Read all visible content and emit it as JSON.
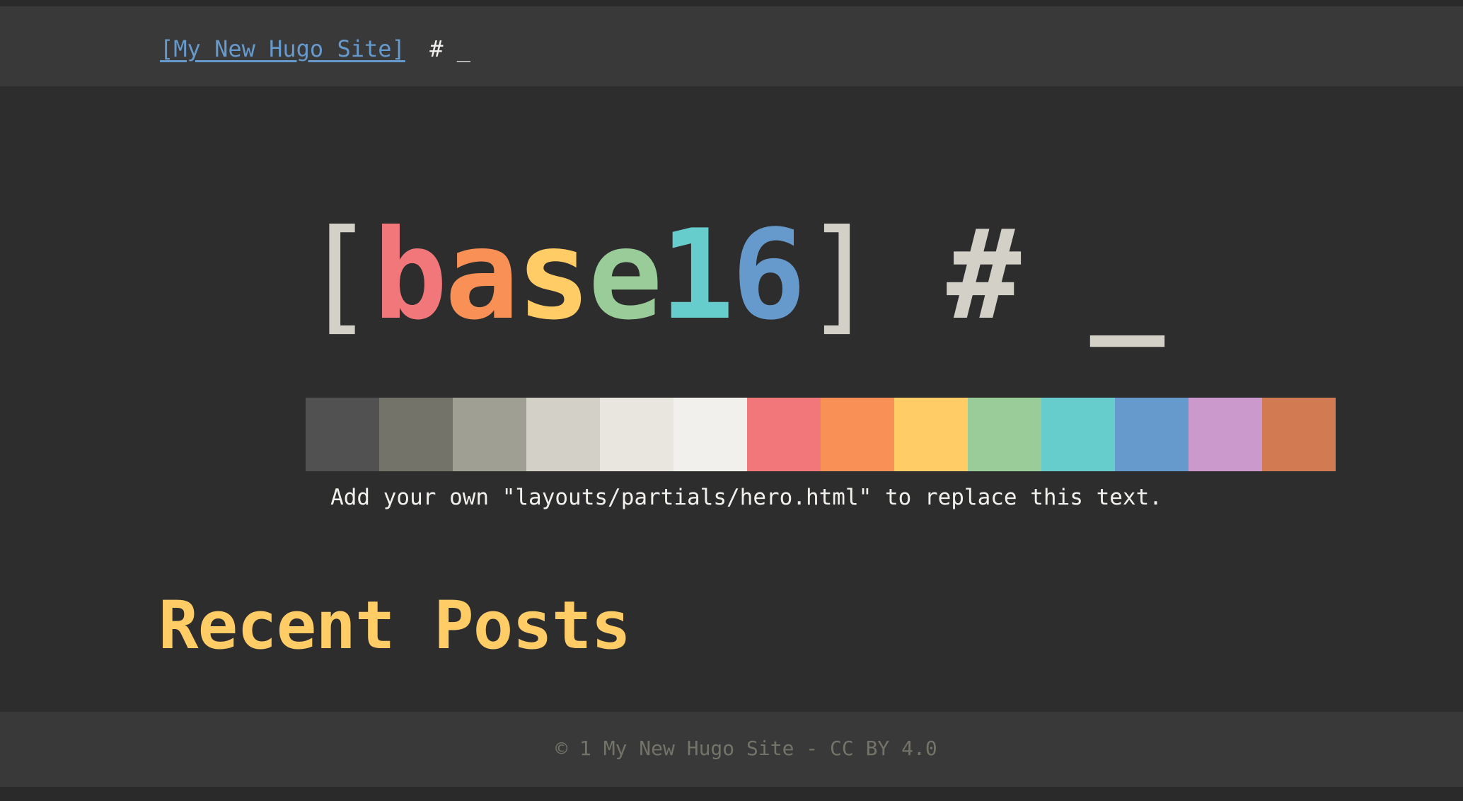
{
  "header": {
    "site_title": "[My New Hugo Site]",
    "prompt": " # _"
  },
  "hero": {
    "logo": {
      "open_bracket": "[",
      "letters": [
        {
          "char": "b",
          "color": "#f2777a"
        },
        {
          "char": "a",
          "color": "#f99157"
        },
        {
          "char": "s",
          "color": "#ffcc66"
        },
        {
          "char": "e",
          "color": "#99cc99"
        },
        {
          "char": "1",
          "color": "#66cccc"
        },
        {
          "char": "6",
          "color": "#6699cc"
        }
      ],
      "close_bracket": "]",
      "tail": " # _"
    },
    "palette": [
      "#2d2d2d",
      "#515151",
      "#747369",
      "#a09f93",
      "#d3d0c8",
      "#e8e6df",
      "#f2f0ec",
      "#f2777a",
      "#f99157",
      "#ffcc66",
      "#99cc99",
      "#66cccc",
      "#6699cc",
      "#cc99cc",
      "#d27b53"
    ],
    "note": "Add your own \"layouts/partials/hero.html\" to replace this text."
  },
  "main": {
    "section_title": "Recent Posts"
  },
  "footer": {
    "text": "© 1 My New Hugo Site - CC BY 4.0"
  }
}
